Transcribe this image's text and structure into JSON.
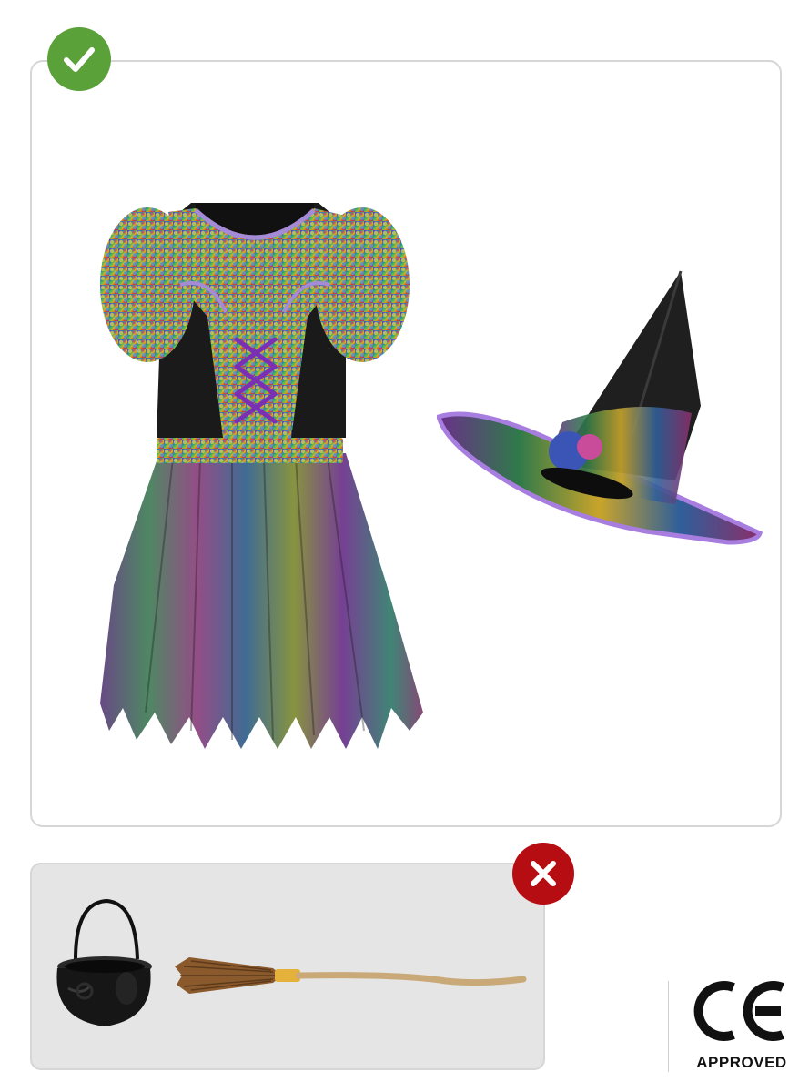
{
  "included": {
    "items": [
      "dress",
      "hat"
    ]
  },
  "excluded": {
    "items": [
      "cauldron",
      "broom"
    ]
  },
  "badges": {
    "included_icon": "checkmark-icon",
    "included_color": "#5aa13a",
    "excluded_icon": "close-icon",
    "excluded_color": "#b50d12"
  },
  "certification": {
    "mark": "CE",
    "label": "APPROVED"
  }
}
